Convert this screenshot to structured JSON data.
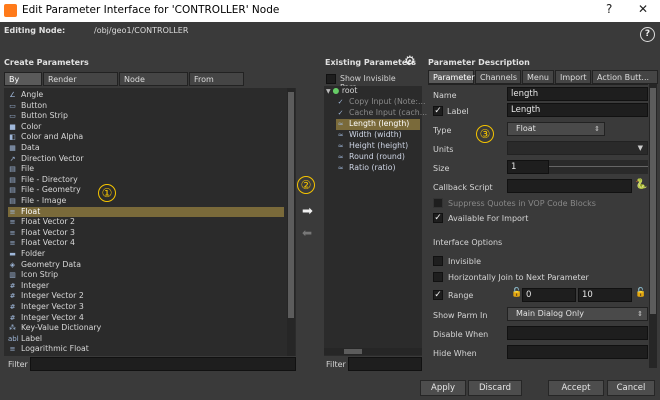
{
  "window": {
    "title": "Edit Parameter Interface for 'CONTROLLER' Node"
  },
  "editing": {
    "label": "Editing Node:",
    "path": "/obj/geo1/CONTROLLER"
  },
  "create": {
    "header": "Create Parameters",
    "tabs": [
      "By Type",
      "Render Properties",
      "Node Properties",
      "From Nodes"
    ],
    "items": [
      "Angle",
      "Button",
      "Button Strip",
      "Color",
      "Color and Alpha",
      "Data",
      "Direction Vector",
      "File",
      "File - Directory",
      "File - Geometry",
      "File - Image",
      "Float",
      "Float Vector 2",
      "Float Vector 3",
      "Float Vector 4",
      "Folder",
      "Geometry Data",
      "Icon Strip",
      "Integer",
      "Integer Vector 2",
      "Integer Vector 3",
      "Integer Vector 4",
      "Key-Value Dictionary",
      "Label",
      "Logarithmic Float"
    ],
    "filter_label": "Filter"
  },
  "existing": {
    "header": "Existing Parameters",
    "show_invisible": "Show Invisible Para...",
    "root": "root",
    "items": [
      "Copy Input (Note:...",
      "Cache Input (cach...",
      "Length (length)",
      "Width (width)",
      "Height (height)",
      "Round (round)",
      "Ratio (ratio)"
    ],
    "filter_label": "Filter"
  },
  "desc": {
    "header": "Parameter Description",
    "tabs": [
      "Parameter",
      "Channels",
      "Menu",
      "Import",
      "Action Butt..."
    ],
    "name_label": "Name",
    "name_value": "length",
    "label_label": "Label",
    "label_value": "Length",
    "type_label": "Type",
    "type_value": "Float",
    "units_label": "Units",
    "size_label": "Size",
    "size_value": "1",
    "callback_label": "Callback Script",
    "suppress": "Suppress Quotes in VOP Code Blocks",
    "available": "Available For Import",
    "interface_options": "Interface Options",
    "invisible": "Invisible",
    "horiz_join": "Horizontally Join to Next Parameter",
    "range_label": "Range",
    "range_min": "0",
    "range_max": "10",
    "show_parm_label": "Show Parm In",
    "show_parm_value": "Main Dialog Only",
    "disable_when": "Disable When",
    "hide_when": "Hide When"
  },
  "buttons": {
    "apply": "Apply",
    "discard": "Discard",
    "accept": "Accept",
    "cancel": "Cancel"
  },
  "badges": {
    "one": "①",
    "two": "②",
    "three": "③"
  },
  "colors": {
    "selection": "#7a6a3a",
    "badge": "#f5c400",
    "accent": "#ff7a1a"
  }
}
